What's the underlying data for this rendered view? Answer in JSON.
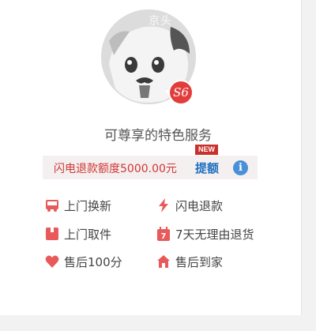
{
  "avatar": {
    "watermark": "京头",
    "level_badge": "S6"
  },
  "headline": "可尊享的特色服务",
  "refund": {
    "quota_text": "闪电退款额度5000.00元",
    "raise_label": "提额",
    "new_tag": "NEW",
    "info_glyph": "i"
  },
  "colors": {
    "accent_red": "#e85a5a",
    "link_blue": "#1f6fbf",
    "info_blue": "#4a90d9"
  },
  "services": [
    {
      "label": "上门换新",
      "icon": "van-icon"
    },
    {
      "label": "闪电退款",
      "icon": "lightning-icon"
    },
    {
      "label": "上门取件",
      "icon": "package-icon"
    },
    {
      "label": "7天无理由退货",
      "icon": "calendar-7-icon"
    },
    {
      "label": "售后100分",
      "icon": "heart-icon"
    },
    {
      "label": "售后到家",
      "icon": "house-icon"
    }
  ]
}
